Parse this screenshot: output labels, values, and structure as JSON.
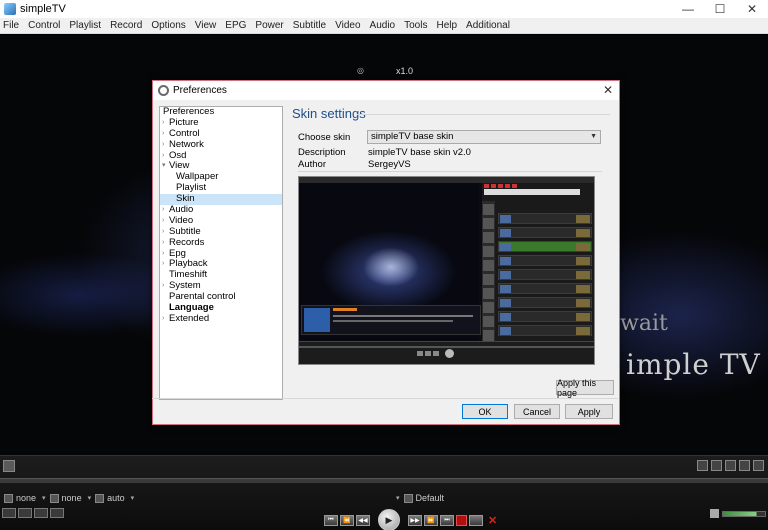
{
  "window": {
    "title": "simpleTV",
    "controls": [
      "—",
      "☐",
      "✕"
    ]
  },
  "menu": [
    "File",
    "Control",
    "Playlist",
    "Record",
    "Options",
    "View",
    "EPG",
    "Power",
    "Subtitle",
    "Video",
    "Audio",
    "Tools",
    "Help",
    "Additional"
  ],
  "background": {
    "logo_text": "imple TV",
    "logo_text2": "wait"
  },
  "dialog": {
    "title": "Preferences",
    "close": "✕",
    "tree": [
      {
        "label": "Preferences",
        "level": 0,
        "expander": false
      },
      {
        "label": "Picture",
        "level": 1,
        "expander": true
      },
      {
        "label": "Control",
        "level": 1,
        "expander": true
      },
      {
        "label": "Network",
        "level": 1,
        "expander": true
      },
      {
        "label": "Osd",
        "level": 1,
        "expander": true
      },
      {
        "label": "View",
        "level": 1,
        "expander": true,
        "expanded": true
      },
      {
        "label": "Wallpaper",
        "level": 2,
        "expander": false
      },
      {
        "label": "Playlist",
        "level": 2,
        "expander": false
      },
      {
        "label": "Skin",
        "level": 2,
        "expander": false,
        "selected": true
      },
      {
        "label": "Audio",
        "level": 1,
        "expander": true
      },
      {
        "label": "Video",
        "level": 1,
        "expander": true
      },
      {
        "label": "Subtitle",
        "level": 1,
        "expander": true
      },
      {
        "label": "Records",
        "level": 1,
        "expander": true
      },
      {
        "label": "Epg",
        "level": 1,
        "expander": true
      },
      {
        "label": "Playback",
        "level": 1,
        "expander": true
      },
      {
        "label": "Timeshift",
        "level": 1,
        "expander": false
      },
      {
        "label": "System",
        "level": 1,
        "expander": true
      },
      {
        "label": "Parental control",
        "level": 1,
        "expander": false
      },
      {
        "label": "Language",
        "level": 1,
        "expander": false,
        "bold": true
      },
      {
        "label": "Extended",
        "level": 1,
        "expander": true
      }
    ],
    "pane": {
      "title": "Skin settings",
      "choose_skin_label": "Choose skin",
      "choose_skin_value": "simpleTV base skin",
      "description_label": "Description",
      "description_value": "simpleTV base skin v2.0",
      "author_label": "Author",
      "author_value": "SergeyVS"
    },
    "buttons": {
      "apply_page": "Apply this page",
      "ok": "OK",
      "cancel": "Cancel",
      "apply": "Apply"
    }
  },
  "player": {
    "subs": "none",
    "audio": "none",
    "aspect": "auto",
    "preset": "Default",
    "speed": "x1.0",
    "volume_level": 0.8,
    "transport": [
      "⏮",
      "⏪",
      "◀◀",
      "▶",
      "▶▶",
      "⏩",
      "⏭"
    ]
  }
}
